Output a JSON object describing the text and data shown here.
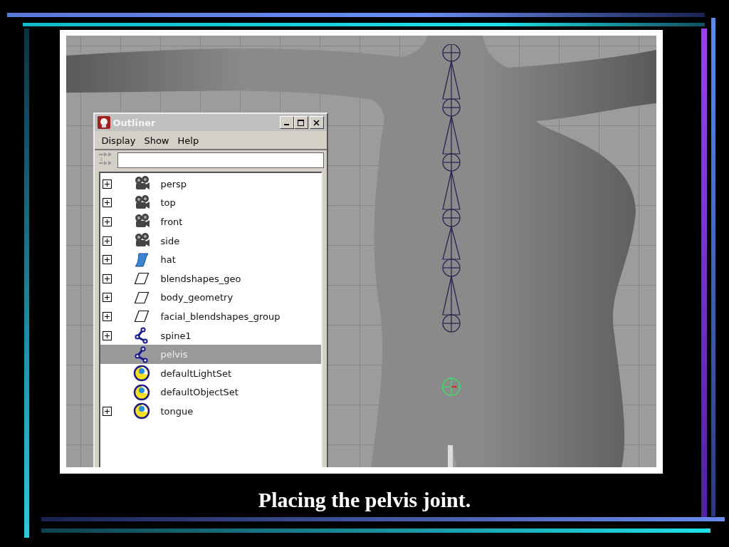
{
  "outliner": {
    "title": "Outliner",
    "menu": [
      "Display",
      "Show",
      "Help"
    ],
    "items": [
      {
        "label": "persp",
        "kind": "camera",
        "expandable": true,
        "selected": false
      },
      {
        "label": "top",
        "kind": "camera",
        "expandable": true,
        "selected": false
      },
      {
        "label": "front",
        "kind": "camera",
        "expandable": true,
        "selected": false
      },
      {
        "label": "side",
        "kind": "camera",
        "expandable": true,
        "selected": false
      },
      {
        "label": "hat",
        "kind": "surface",
        "expandable": true,
        "selected": false
      },
      {
        "label": "blendshapes_geo",
        "kind": "transform",
        "expandable": true,
        "selected": false
      },
      {
        "label": "body_geometry",
        "kind": "transform",
        "expandable": true,
        "selected": false
      },
      {
        "label": "facial_blendshapes_group",
        "kind": "transform",
        "expandable": true,
        "selected": false
      },
      {
        "label": "spine1",
        "kind": "joint",
        "expandable": true,
        "selected": false
      },
      {
        "label": "pelvis",
        "kind": "joint",
        "expandable": false,
        "selected": true
      },
      {
        "label": "defaultLightSet",
        "kind": "set",
        "expandable": false,
        "selected": false
      },
      {
        "label": "defaultObjectSet",
        "kind": "set",
        "expandable": false,
        "selected": false
      },
      {
        "label": "tongue",
        "kind": "set",
        "expandable": true,
        "selected": false
      }
    ]
  },
  "caption": "Placing the pelvis joint."
}
